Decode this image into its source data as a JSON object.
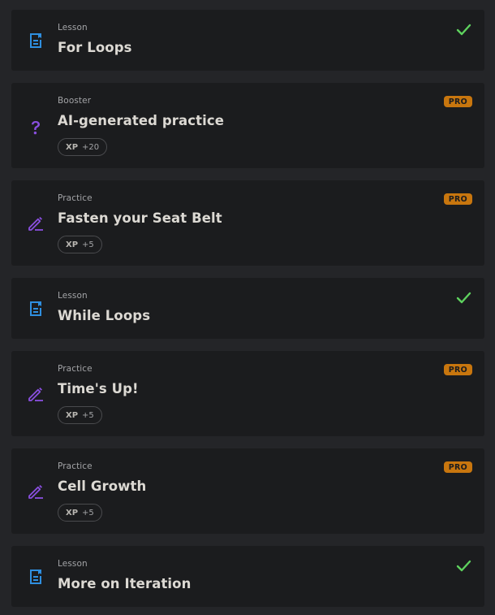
{
  "colors": {
    "page_bg": "#242528",
    "card_bg": "#1b1c1e",
    "lesson_icon": "#2f8fe0",
    "practice_icon": "#8a4fe0",
    "pro_badge": "#c8760e",
    "check": "#5ed25e"
  },
  "items": [
    {
      "kind": "Lesson",
      "title": "For Loops",
      "icon": "lesson-doc-icon",
      "completed": true
    },
    {
      "kind": "Booster",
      "title": "AI-generated practice",
      "icon": "question-mark-icon",
      "badge": "PRO",
      "xp_label": "XP",
      "xp_value": "+20"
    },
    {
      "kind": "Practice",
      "title": "Fasten your Seat Belt",
      "icon": "pencil-icon",
      "badge": "PRO",
      "xp_label": "XP",
      "xp_value": "+5"
    },
    {
      "kind": "Lesson",
      "title": "While Loops",
      "icon": "lesson-doc-icon",
      "completed": true
    },
    {
      "kind": "Practice",
      "title": "Time's Up!",
      "icon": "pencil-icon",
      "badge": "PRO",
      "xp_label": "XP",
      "xp_value": "+5"
    },
    {
      "kind": "Practice",
      "title": "Cell Growth",
      "icon": "pencil-icon",
      "badge": "PRO",
      "xp_label": "XP",
      "xp_value": "+5"
    },
    {
      "kind": "Lesson",
      "title": "More on Iteration",
      "icon": "lesson-doc-icon",
      "completed": true
    }
  ]
}
